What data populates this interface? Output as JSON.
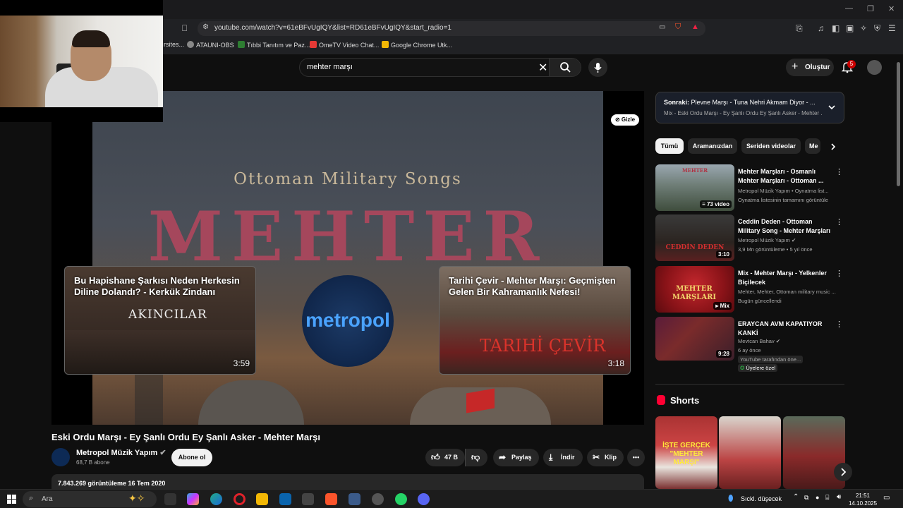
{
  "browser": {
    "url": "youtube.com/watch?v=61eBFvUgIQY&list=RD61eBFvUgIQY&start_radio=1",
    "bookmarks": [
      "rsites...",
      "ATAUNI-OBS",
      "Tıbbi Tanıtım ve Paz...",
      "OmeTV Video Chat...",
      "Google Chrome Utk..."
    ]
  },
  "header": {
    "search_query": "mehter marşı",
    "create_label": "Oluştur",
    "notif_count": "5"
  },
  "video": {
    "title": "Eski Ordu Marşı - Ey Şanlı Ordu Ey Şanlı Asker - Mehter Marşı",
    "frame_heading": "Ottoman Military Songs",
    "frame_big": "MEHTER",
    "hide_label": "Gizle",
    "endcards": [
      {
        "title": "Bu Hapishane Şarkısı Neden Herkesin Diline Dolandı? - Kerkük Zindanı",
        "duration": "3:59",
        "art": "AKINCILAR"
      },
      {
        "title": "Tarihi Çevir - Mehter Marşı: Geçmişten Gelen Bir Kahramanlık Nefesi!",
        "duration": "3:18",
        "art": "TARIHİ ÇEVİR"
      }
    ],
    "logo_text": "metropol"
  },
  "channel": {
    "name": "Metropol Müzik Yapım",
    "subs": "68,7 B abone",
    "subscribe_label": "Abone ol"
  },
  "actions": {
    "likes": "47 B",
    "share": "Paylaş",
    "download": "İndir",
    "clip": "Klip"
  },
  "description": {
    "stats": "7.843.269 görüntüleme  16 Tem 2020"
  },
  "sidebar": {
    "next_title_prefix": "Sonraki:",
    "next_title": "Plevne Marşı - Tuna Nehri Akmam Diyor - ...",
    "next_sub": "Mix - Eski Ordu Marşı - Ey Şanlı Ordu Ey Şanlı Asker - Mehter ...",
    "chips": [
      "Tümü",
      "Aramanızdan",
      "Seriden videolar",
      "Me"
    ],
    "recs": [
      {
        "title": "Mehter Marşları - Osmanlı Mehter Marşları - Ottoman ...",
        "meta1": "Metropol Müzik Yapım • Oynatma list...",
        "meta2": "Oynatma listesinin tamamını görüntüle",
        "dur": "73 video"
      },
      {
        "title": "Ceddin Deden - Ottoman Military Song - Mehter Marşları",
        "meta1": "Metropol Müzik Yapım",
        "meta2": "3,9 Mn görüntüleme • 5 yıl önce",
        "dur": "3:10"
      },
      {
        "title": "Mix - Mehter Marşı - Yelkenler Biçilecek",
        "meta1": "Mehter, Mehter, Ottoman military music ...",
        "meta2": "Bugün güncellendi",
        "dur": "Mix"
      },
      {
        "title": "ERAYCAN AVM KAPATIYOR KANKİ",
        "meta1": "Mevtcan Bahav",
        "meta2": "6 ay önce",
        "dur": "9:28",
        "badge1": "YouTube tarafından öne...",
        "badge2": "Üyelere özel"
      }
    ],
    "thumb_texts": [
      "MEHTER",
      "CEDDİN DEDEN",
      "MEHTER MARŞLARI"
    ],
    "shorts_title": "Shorts",
    "short_caption": "İŞTE GERÇEK \"MEHTER MARŞI\""
  },
  "taskbar": {
    "search_label": "Ara",
    "weather": "Sıckl. düşecek",
    "time": "21:51",
    "date": "14.10.2025"
  }
}
